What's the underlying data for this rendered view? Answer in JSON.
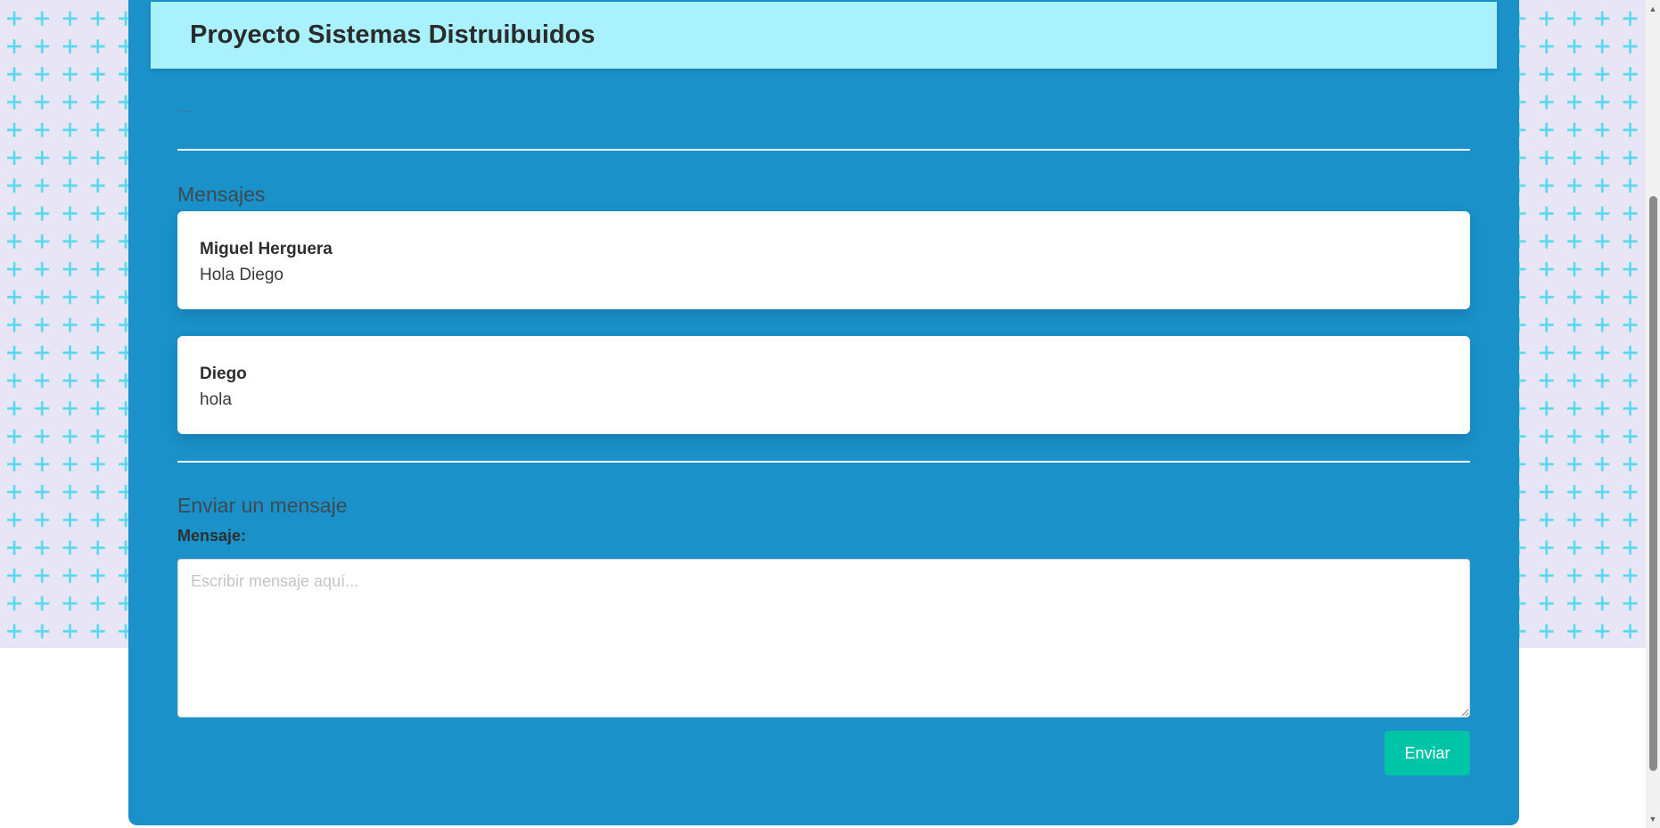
{
  "header": {
    "title": "Proyecto Sistemas Distruibuidos"
  },
  "status_text": "....",
  "messages_section": {
    "title": "Mensajes",
    "messages": [
      {
        "author": "Miguel Herguera",
        "text": "Hola Diego"
      },
      {
        "author": "Diego",
        "text": "hola"
      }
    ]
  },
  "send_section": {
    "title": "Enviar un mensaje",
    "field_label": "Mensaje:",
    "placeholder": "Escribir mensaje aquí...",
    "value": "",
    "send_label": "Enviar"
  },
  "colors": {
    "card": "#1a91c9",
    "header": "#a8f1fd",
    "button": "#00c4a7",
    "pattern_plus": "#56d8ef",
    "pattern_bg": "#e8e6f6"
  },
  "icons": {
    "scroll_up": "chevron-up-icon",
    "scroll_down": "chevron-down-icon"
  }
}
